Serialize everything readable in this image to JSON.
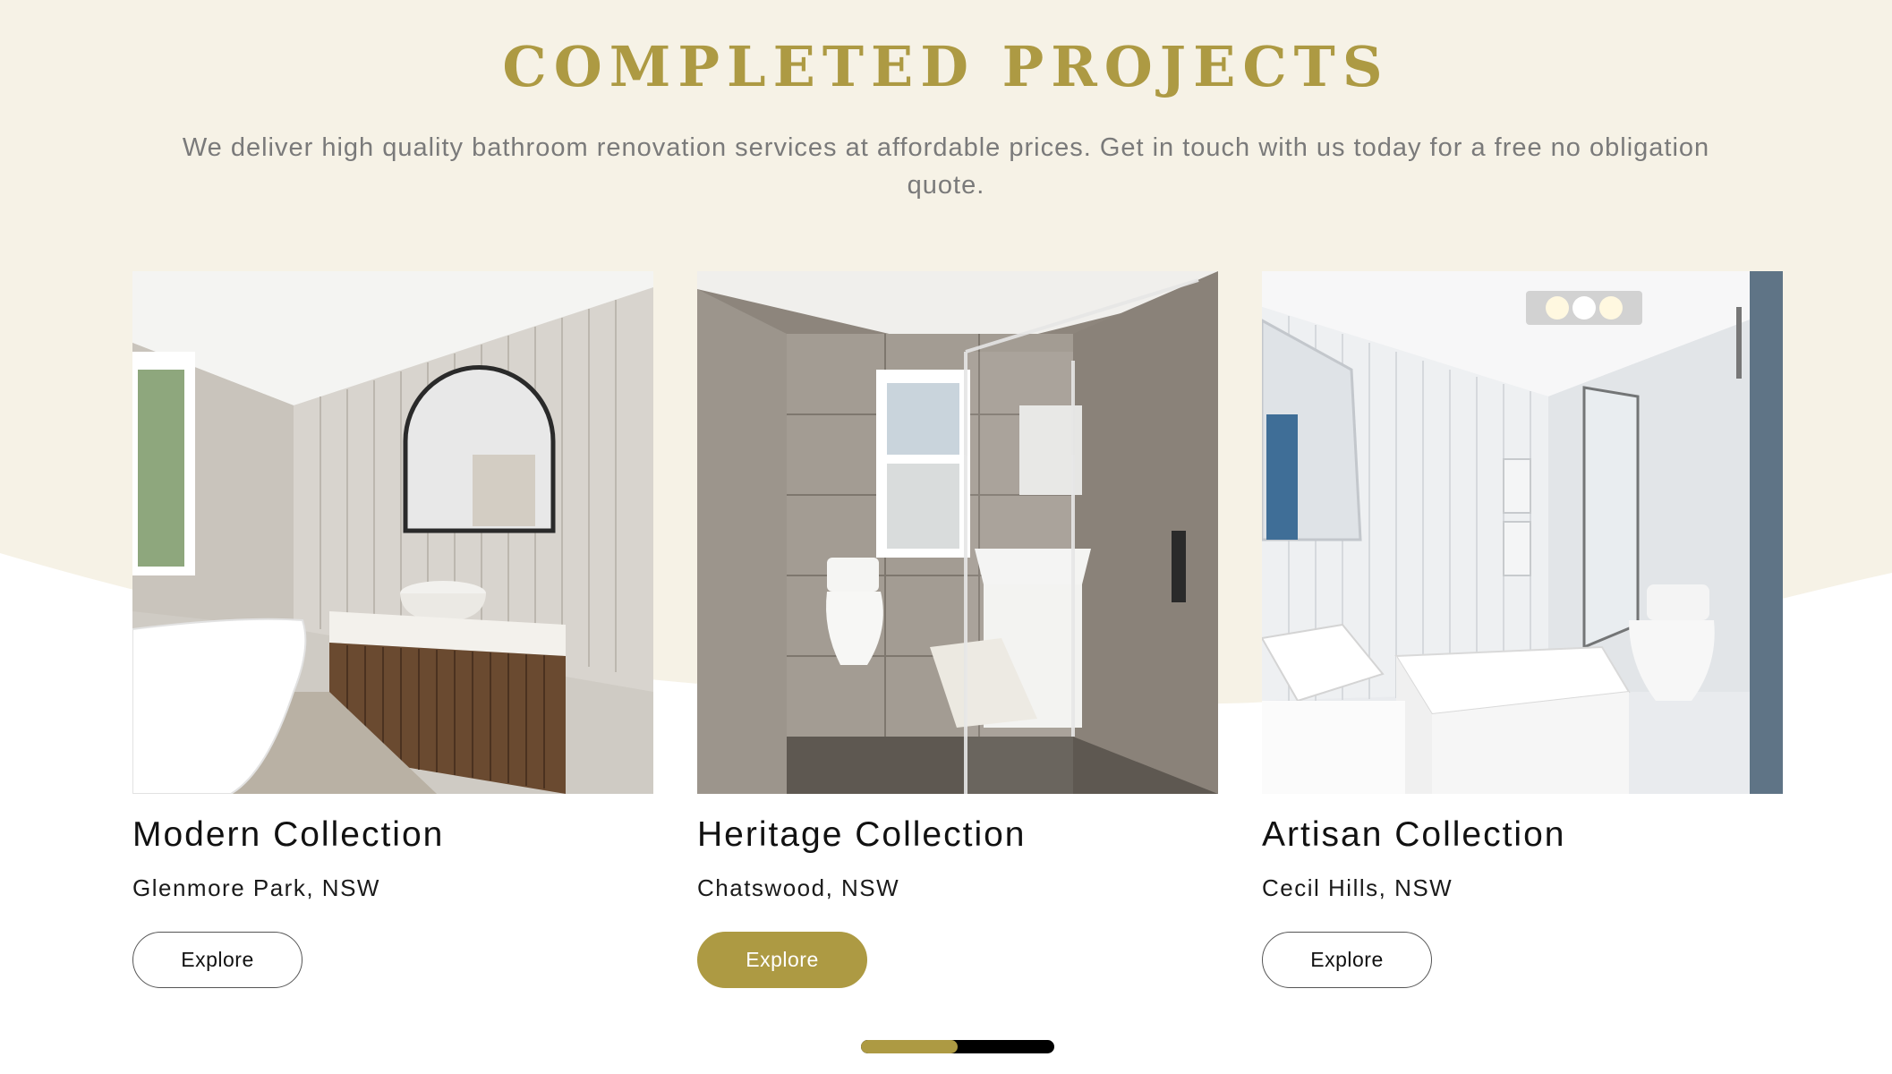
{
  "section": {
    "title": "COMPLETED PROJECTS",
    "subtitle": "We deliver high quality bathroom renovation services at affordable prices. Get in touch with us today for a free no obligation quote."
  },
  "projects": [
    {
      "title": "Modern Collection",
      "location": "Glenmore Park, NSW",
      "button_label": "Explore",
      "image": "bathroom-photo-freestanding-tub-arched-mirror"
    },
    {
      "title": "Heritage Collection",
      "location": "Chatswood, NSW",
      "button_label": "Explore",
      "image": "bathroom-photo-glass-shower-window-toilet",
      "active": true
    },
    {
      "title": "Artisan Collection",
      "location": "Cecil Hills, NSW",
      "button_label": "Explore",
      "image": "bathroom-photo-white-tiles-bath-shower-screen"
    }
  ],
  "carousel": {
    "progress": 0.5
  },
  "colors": {
    "accent": "#ad9a43",
    "cream_background": "#f6f2e6",
    "body_text": "#7a7a7a",
    "slider_track": "#000000"
  }
}
